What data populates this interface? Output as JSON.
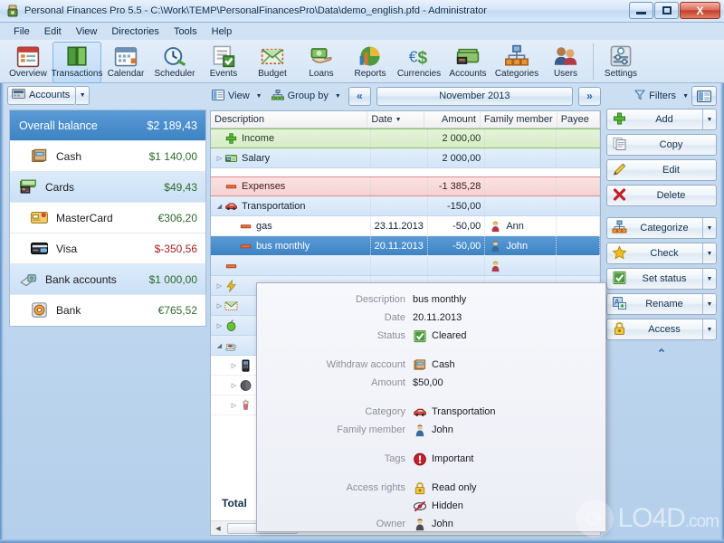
{
  "window": {
    "title": "Personal Finances Pro 5.5 - C:\\Work\\TEMP\\PersonalFinancesPro\\Data\\demo_english.pfd - Administrator",
    "minimize_label": "—",
    "maximize_label": "❐",
    "close_label": "X"
  },
  "menu": {
    "items": [
      "File",
      "Edit",
      "View",
      "Directories",
      "Tools",
      "Help"
    ]
  },
  "ribbon": {
    "items": [
      {
        "label": "Overview",
        "icon": "calendar-list-icon",
        "selected": false
      },
      {
        "label": "Transactions",
        "icon": "book-icon",
        "selected": true
      },
      {
        "label": "Calendar",
        "icon": "calendar-icon",
        "selected": false
      },
      {
        "label": "Scheduler",
        "icon": "clock-icon",
        "selected": false
      },
      {
        "label": "Events",
        "icon": "checklist-icon",
        "selected": false
      },
      {
        "label": "Budget",
        "icon": "envelope-money-icon",
        "selected": false
      },
      {
        "label": "Loans",
        "icon": "money-hand-icon",
        "selected": false
      },
      {
        "label": "Reports",
        "icon": "piechart-icon",
        "selected": false
      },
      {
        "label": "Currencies",
        "icon": "currency-icon",
        "selected": false
      },
      {
        "label": "Accounts",
        "icon": "banknotes-icon",
        "selected": false
      },
      {
        "label": "Categories",
        "icon": "hierarchy-icon",
        "selected": false
      },
      {
        "label": "Users",
        "icon": "users-icon",
        "selected": false
      },
      {
        "label": "Settings",
        "icon": "settings-icon",
        "selected": false
      }
    ]
  },
  "sidebar": {
    "accounts_button": "Accounts",
    "rows": [
      {
        "name": "Overall balance",
        "value": "$2 189,43",
        "kind": "selected",
        "icon": "none",
        "indent": false,
        "negative": false
      },
      {
        "name": "Cash",
        "value": "$1 140,00",
        "kind": "item",
        "icon": "wallet-icon",
        "indent": true,
        "negative": false
      },
      {
        "name": "Cards",
        "value": "$49,43",
        "kind": "group",
        "icon": "cards-icon",
        "indent": false,
        "negative": false
      },
      {
        "name": "MasterCard",
        "value": "€306,20",
        "kind": "item",
        "icon": "mastercard-icon",
        "indent": true,
        "negative": false
      },
      {
        "name": "Visa",
        "value": "$-350,56",
        "kind": "item",
        "icon": "visa-icon",
        "indent": true,
        "negative": true
      },
      {
        "name": "Bank accounts",
        "value": "$1 000,00",
        "kind": "group",
        "icon": "bank-icon",
        "indent": false,
        "negative": false
      },
      {
        "name": "Bank",
        "value": "€765,52",
        "kind": "item",
        "icon": "disc-icon",
        "indent": true,
        "negative": false
      }
    ]
  },
  "grid": {
    "view_label": "View",
    "groupby_label": "Group by",
    "prev_label": "«",
    "next_label": "»",
    "period": "November 2013",
    "columns": [
      "Description",
      "Date",
      "Amount",
      "Family member",
      "Payee"
    ],
    "sorted_column": "Date",
    "total_label": "Total",
    "rows": [
      {
        "type": "income",
        "icon": "plus-icon",
        "desc": "Income",
        "date": "",
        "amount": "2 000,00",
        "member": "",
        "member_icon": "",
        "payee": "",
        "expander": ""
      },
      {
        "type": "cat",
        "icon": "salary-icon",
        "desc": "Salary",
        "date": "",
        "amount": "2 000,00",
        "member": "",
        "member_icon": "",
        "payee": "",
        "expander": "collapsed"
      },
      {
        "type": "gap",
        "icon": "",
        "desc": "",
        "date": "",
        "amount": "",
        "member": "",
        "member_icon": "",
        "payee": "",
        "expander": ""
      },
      {
        "type": "expense",
        "icon": "minus-icon",
        "desc": "Expenses",
        "date": "",
        "amount": "-1 385,28",
        "member": "",
        "member_icon": "",
        "payee": "",
        "expander": ""
      },
      {
        "type": "cat",
        "icon": "car-icon",
        "desc": "Transportation",
        "date": "",
        "amount": "-150,00",
        "member": "",
        "member_icon": "",
        "payee": "",
        "expander": "expanded"
      },
      {
        "type": "item",
        "icon": "minus-icon",
        "desc": "gas",
        "date": "23.11.2013",
        "amount": "-50,00",
        "member": "Ann",
        "member_icon": "woman-icon",
        "payee": "",
        "expander": ""
      },
      {
        "type": "selected",
        "icon": "minus-icon",
        "desc": "bus monthly",
        "date": "20.11.2013",
        "amount": "-50,00",
        "member": "John",
        "member_icon": "man-icon",
        "payee": "",
        "expander": ""
      },
      {
        "type": "cat",
        "icon": "minus-icon",
        "desc": "",
        "date": "",
        "amount": "",
        "member": "",
        "member_icon": "woman-icon",
        "payee": "",
        "expander": ""
      },
      {
        "type": "cat",
        "icon": "lightning-icon",
        "desc": "",
        "date": "",
        "amount": "",
        "member": "",
        "member_icon": "",
        "payee": "",
        "expander": "collapsed"
      },
      {
        "type": "cat",
        "icon": "mail-icon",
        "desc": "",
        "date": "",
        "amount": "",
        "member": "",
        "member_icon": "",
        "payee": "",
        "expander": "collapsed"
      },
      {
        "type": "cat",
        "icon": "apple-icon",
        "desc": "",
        "date": "",
        "amount": "",
        "member": "",
        "member_icon": "",
        "payee": "",
        "expander": "collapsed"
      },
      {
        "type": "cat",
        "icon": "coffee-icon",
        "desc": "",
        "date": "",
        "amount": "",
        "member": "",
        "member_icon": "",
        "payee": "",
        "expander": "expanded"
      },
      {
        "type": "item",
        "icon": "phone-icon",
        "desc": "",
        "date": "",
        "amount": "",
        "member": "",
        "member_icon": "",
        "payee": "",
        "expander": "collapsed"
      },
      {
        "type": "item",
        "icon": "ball-icon",
        "desc": "",
        "date": "",
        "amount": "",
        "member": "",
        "member_icon": "",
        "payee": "",
        "expander": "collapsed"
      },
      {
        "type": "item",
        "icon": "drink-icon",
        "desc": "",
        "date": "",
        "amount": "",
        "member": "",
        "member_icon": "",
        "payee": "",
        "expander": "collapsed"
      }
    ]
  },
  "actions": {
    "filters_label": "Filters",
    "layout_icon": "layout-icon",
    "buttons": [
      {
        "label": "Add",
        "icon": "plus-icon",
        "split": true,
        "gap_after": false
      },
      {
        "label": "Copy",
        "icon": "copy-icon",
        "split": false,
        "gap_after": false
      },
      {
        "label": "Edit",
        "icon": "pencil-icon",
        "split": false,
        "gap_after": false
      },
      {
        "label": "Delete",
        "icon": "delete-icon",
        "split": false,
        "gap_after": true
      },
      {
        "label": "Categorize",
        "icon": "hierarchy-icon",
        "split": true,
        "gap_after": false
      },
      {
        "label": "Check",
        "icon": "star-icon",
        "split": true,
        "gap_after": false
      },
      {
        "label": "Set status",
        "icon": "checkbox-icon",
        "split": true,
        "gap_after": false
      },
      {
        "label": "Rename",
        "icon": "rename-icon",
        "split": true,
        "gap_after": false
      },
      {
        "label": "Access",
        "icon": "lock-icon",
        "split": true,
        "gap_after": false
      }
    ],
    "collapse_icon": "chevron-up-icon"
  },
  "tooltip": {
    "rows": [
      {
        "label": "Description",
        "value": "bus monthly",
        "icon": "",
        "spacer_before": false
      },
      {
        "label": "Date",
        "value": "20.11.2013",
        "icon": "",
        "spacer_before": false
      },
      {
        "label": "Status",
        "value": "Cleared",
        "icon": "checkbox-icon",
        "spacer_before": false
      },
      {
        "label": "Withdraw account",
        "value": "Cash",
        "icon": "wallet-icon",
        "spacer_before": true
      },
      {
        "label": "Amount",
        "value": "$50,00",
        "icon": "",
        "spacer_before": false
      },
      {
        "label": "Category",
        "value": "Transportation",
        "icon": "car-icon",
        "spacer_before": true
      },
      {
        "label": "Family member",
        "value": "John",
        "icon": "man-icon",
        "spacer_before": false
      },
      {
        "label": "Tags",
        "value": "Important",
        "icon": "important-icon",
        "spacer_before": true
      },
      {
        "label": "Access rights",
        "value": "Read only",
        "icon": "lock-icon",
        "spacer_before": true
      },
      {
        "label": "",
        "value": "Hidden",
        "icon": "hidden-icon",
        "spacer_before": false
      },
      {
        "label": "Owner",
        "value": "John",
        "icon": "man-dark-icon",
        "spacer_before": false
      }
    ]
  },
  "watermark": {
    "text": "LO4D",
    "suffix": ".com"
  },
  "colors": {
    "accent": "#3d83c4",
    "income": "#8cc06a",
    "expense": "#dd8b8b",
    "positive": "#2e6b2e",
    "negative": "#a52020",
    "title": "#0b2a4a"
  }
}
